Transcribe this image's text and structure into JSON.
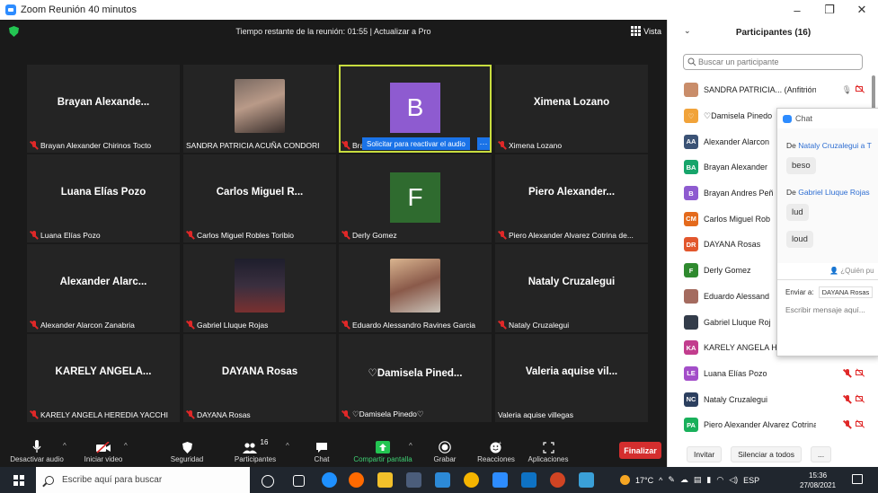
{
  "window": {
    "title": "Zoom Reunión 40 minutos",
    "controls": [
      "–",
      "❐",
      "✕"
    ]
  },
  "meeting": {
    "timer_text": "Tiempo restante de la reunión: 01:55 | Actualizar a Pro",
    "view_label": "Vista",
    "unmute_request": "Solicitar para reactivar el audio",
    "unmute_more": "···",
    "tiles": [
      {
        "big": "Brayan Alexande...",
        "label": "Brayan Alexander Chirinos Tocto",
        "muted": true
      },
      {
        "big": "",
        "label": "SANDRA PATRICIA ACUÑA CONDORI",
        "muted": false,
        "photo": "woman-photo"
      },
      {
        "big": "",
        "label": "Brayan Andres Peñaloza Jesús",
        "muted": true,
        "letter": "B",
        "letter_color": "#8e5bd0",
        "active": true
      },
      {
        "big": "Ximena Lozano",
        "label": "Ximena Lozano",
        "muted": true
      },
      {
        "big": "Luana Elías Pozo",
        "label": "Luana Elías Pozo",
        "muted": true
      },
      {
        "big": "Carlos Miguel R...",
        "label": "Carlos Miguel Robles Toribio",
        "muted": true
      },
      {
        "big": "",
        "label": "Derly Gomez",
        "muted": true,
        "letter": "F",
        "letter_color": "#2f6b2f"
      },
      {
        "big": "Piero Alexander...",
        "label": "Piero Alexander Alvarez Cotrina de...",
        "muted": true
      },
      {
        "big": "Alexander Alarc...",
        "label": "Alexander Alarcon Zanabria",
        "muted": true
      },
      {
        "big": "",
        "label": "Gabriel Lluque Rojas",
        "muted": true,
        "photo": "anime-photo"
      },
      {
        "big": "",
        "label": "Eduardo Alessandro Ravines Garcia",
        "muted": true,
        "photo": "boy-photo"
      },
      {
        "big": "Nataly Cruzalegui",
        "label": "Nataly Cruzalegui",
        "muted": true
      },
      {
        "big": "KARELY ANGELA...",
        "label": "KARELY ANGELA HEREDIA YACCHI",
        "muted": true
      },
      {
        "big": "DAYANA Rosas",
        "label": "DAYANA Rosas",
        "muted": true
      },
      {
        "big": "♡Damisela Pined...",
        "label": "♡Damisela Pinedo♡",
        "muted": true
      },
      {
        "big": "Valeria aquise vil...",
        "label": "Valeria aquise villegas",
        "muted": false
      }
    ]
  },
  "toolbar": {
    "mute": "Desactivar audio",
    "video": "Iniciar video",
    "security": "Seguridad",
    "participants": "Participantes",
    "participants_count": "16",
    "chat": "Chat",
    "share": "Compartir pantalla",
    "record": "Grabar",
    "reactions": "Reacciones",
    "apps": "Aplicaciones",
    "end": "Finalizar"
  },
  "participants_panel": {
    "title": "Participantes (16)",
    "search_placeholder": "Buscar un participante",
    "rows": [
      {
        "initials": "",
        "name": "SANDRA PATRICIA... (Anfitrión, yo)",
        "color": "#c98d6a"
      },
      {
        "initials": "♡",
        "name": "♡Damisela Pinedo",
        "color": "#f1a33a"
      },
      {
        "initials": "AA",
        "name": "Alexander Alarcon",
        "color": "#3b5376"
      },
      {
        "initials": "BA",
        "name": "Brayan Alexander",
        "color": "#17a56b"
      },
      {
        "initials": "B",
        "name": "Brayan Andres Peñ",
        "color": "#8e5bd0"
      },
      {
        "initials": "CM",
        "name": "Carlos Miguel Rob",
        "color": "#e46a1c"
      },
      {
        "initials": "DR",
        "name": "DAYANA Rosas",
        "color": "#e2572d"
      },
      {
        "initials": "F",
        "name": "Derly Gomez",
        "color": "#2f8a2f"
      },
      {
        "initials": "",
        "name": "Eduardo Alessand",
        "color": "#a46b5f"
      },
      {
        "initials": "",
        "name": "Gabriel Lluque Roj",
        "color": "#333c4a"
      },
      {
        "initials": "KA",
        "name": "KARELY ANGELA H",
        "color": "#c23d8e"
      },
      {
        "initials": "LE",
        "name": "Luana Elías Pozo",
        "color": "#a34ec9"
      },
      {
        "initials": "NC",
        "name": "Nataly Cruzalegui",
        "color": "#2c3f5f"
      },
      {
        "initials": "PA",
        "name": "Piero Alexander Alvarez Cotrina...",
        "color": "#19b05b"
      }
    ],
    "invite": "Invitar",
    "mute_all": "Silenciar a todos",
    "more": "..."
  },
  "chat_popup": {
    "title": "Chat",
    "messages": [
      {
        "prefix": "De ",
        "from": "Nataly Cruzalegui a T",
        "text": "beso"
      },
      {
        "prefix": "De ",
        "from": "Gabriel Lluque Rojas",
        "text": "lud"
      },
      {
        "prefix": "",
        "from": "",
        "text": "loud"
      }
    ],
    "who_can_see": "¿Quién pu",
    "send_to_label": "Enviar a:",
    "send_to_value": "DAYANA Rosas",
    "input_placeholder": "Escribir mensaje aquí..."
  },
  "taskbar": {
    "search_placeholder": "Escribe aquí para buscar",
    "weather": "17°C",
    "language": "ESP",
    "time": "15:36",
    "date": "27/08/2021"
  }
}
